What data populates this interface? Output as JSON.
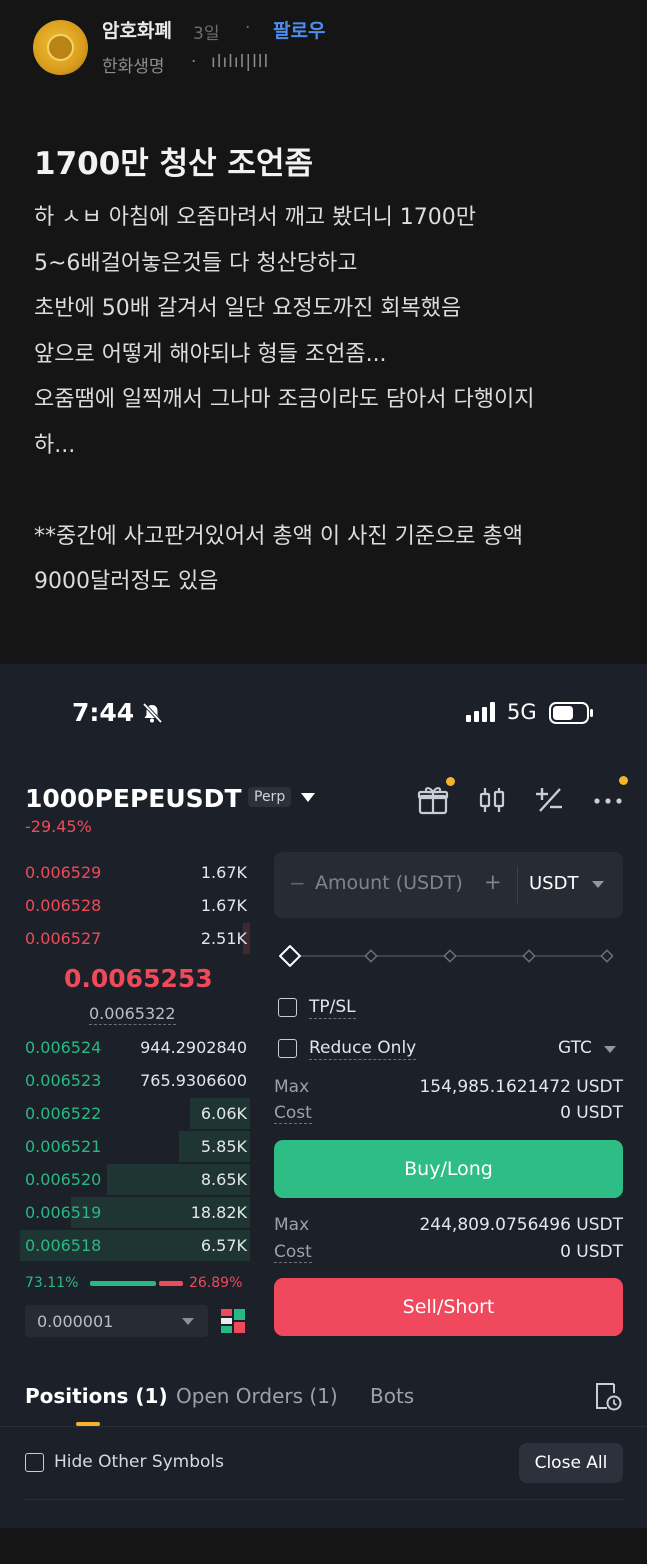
{
  "post": {
    "author": "암호화폐",
    "time": "3일",
    "separator": "·",
    "follow": "팔로우",
    "company": "한화생명",
    "level": "ılılıl|lll",
    "title": "1700만 청산 조언좀",
    "lines": [
      "하 ㅅㅂ 아침에 오줌마려서 깨고 봤더니 1700만",
      "5~6배걸어놓은것들 다 청산당하고",
      "초반에 50배 갈겨서 일단 요정도까진 회복했음",
      "앞으로 어떻게 해야되냐 형들 조언좀...",
      "오줌땜에 일찍깨서 그나마 조금이라도 담아서 다행이지",
      "하...",
      "",
      "**중간에 사고판거있어서 총액 이 사진 기준으로 총액",
      "9000달러정도 있음"
    ]
  },
  "status_bar": {
    "time": "7:44",
    "network": "5G"
  },
  "market": {
    "symbol": "1000PEPEUSDT",
    "type": "Perp",
    "change": "-29.45%"
  },
  "order_book": {
    "asks": [
      {
        "price": "0.006529",
        "qty": "1.67K",
        "depth": 0.0
      },
      {
        "price": "0.006528",
        "qty": "1.67K",
        "depth": 0.0
      },
      {
        "price": "0.006527",
        "qty": "2.51K",
        "depth": 0.03
      }
    ],
    "last_price": "0.0065253",
    "mark_price": "0.0065322",
    "bids": [
      {
        "price": "0.006524",
        "qty": "944.2902840",
        "depth": 0.0
      },
      {
        "price": "0.006523",
        "qty": "765.9306600",
        "depth": 0.0
      },
      {
        "price": "0.006522",
        "qty": "6.06K",
        "depth": 0.26
      },
      {
        "price": "0.006521",
        "qty": "5.85K",
        "depth": 0.31
      },
      {
        "price": "0.006520",
        "qty": "8.65K",
        "depth": 0.62
      },
      {
        "price": "0.006519",
        "qty": "18.82K",
        "depth": 0.78
      },
      {
        "price": "0.006518",
        "qty": "6.57K",
        "depth": 1.0
      }
    ],
    "buy_ratio": "73.11%",
    "sell_ratio": "26.89%",
    "precision": "0.000001"
  },
  "order_form": {
    "minus": "−",
    "amount_placeholder": "Amount (USDT)",
    "plus": "+",
    "unit": "USDT",
    "tpsl_label": "TP/SL",
    "reduce_only_label": "Reduce Only",
    "time_in_force": "GTC",
    "buy": {
      "max_label": "Max",
      "max_value": "154,985.1621472 USDT",
      "cost_label": "Cost",
      "cost_value": "0 USDT",
      "button": "Buy/Long"
    },
    "sell": {
      "max_label": "Max",
      "max_value": "244,809.0756496 USDT",
      "cost_label": "Cost",
      "cost_value": "0 USDT",
      "button": "Sell/Short"
    }
  },
  "positions": {
    "tabs": [
      "Positions (1)",
      "Open Orders (1)",
      "Bots"
    ],
    "hide_other": "Hide Other Symbols",
    "close_all": "Close All"
  },
  "colors": {
    "buy": "#2ebd85",
    "sell": "#f0485c",
    "accent": "#f5b22d",
    "follow": "#4c8df0"
  }
}
